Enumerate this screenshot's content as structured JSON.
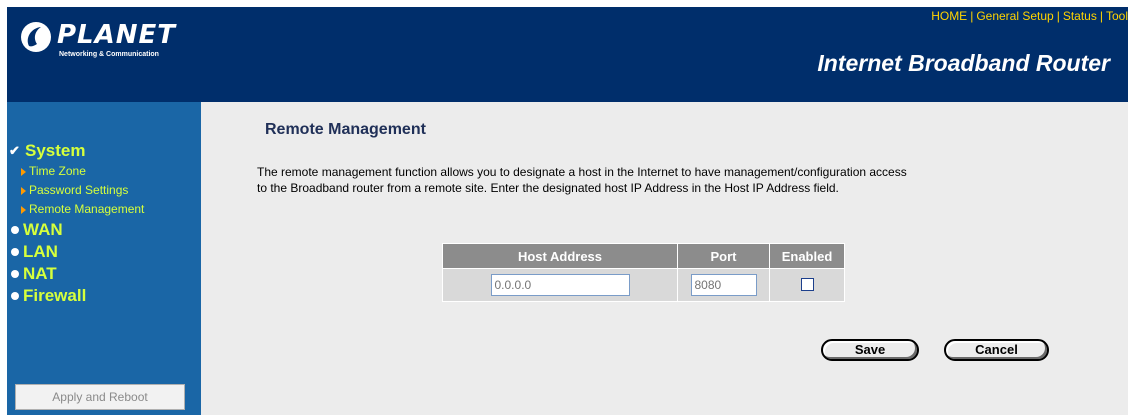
{
  "header": {
    "logo_text": "PLANET",
    "logo_subtitle": "Networking & Communication",
    "top_nav": [
      "HOME",
      "General Setup",
      "Status",
      "Tool"
    ],
    "product_title": "Internet Broadband Router"
  },
  "sidebar": {
    "system": {
      "label": "System",
      "sub_items": [
        "Time Zone",
        "Password Settings",
        "Remote Management"
      ]
    },
    "wan": "WAN",
    "lan": "LAN",
    "nat": "NAT",
    "firewall": "Firewall",
    "apply_button": "Apply and Reboot"
  },
  "main": {
    "title": "Remote Management",
    "description_line1": "The remote management function allows you to designate a host in the Internet to have management/configuration access",
    "description_line2": "to the Broadband router from a remote site. Enter the designated host IP Address in the Host IP Address field.",
    "table": {
      "headers": [
        "Host Address",
        "Port",
        "Enabled"
      ],
      "host_placeholder": "0.0.0.0",
      "port_placeholder": "8080",
      "enabled": false
    },
    "save_button": "Save",
    "cancel_button": "Cancel"
  },
  "colors": {
    "header_bg": "#002e6b",
    "sidebar_bg": "#1a66a6",
    "menu_text": "#d6ff3c",
    "top_nav_text": "#ffd400",
    "content_bg": "#ececec",
    "table_header_bg": "#8c8c8c"
  }
}
